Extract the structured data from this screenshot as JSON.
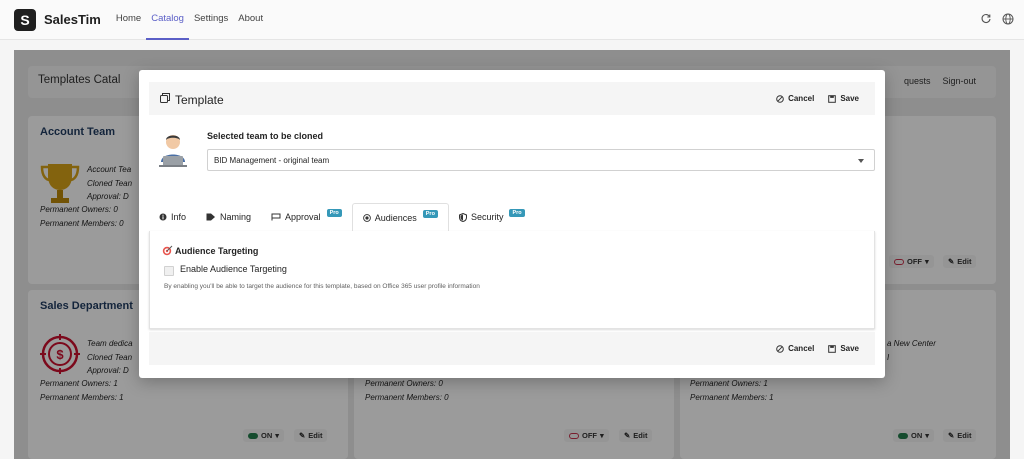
{
  "app": {
    "brand": "SalesTim",
    "logo_letter": "S",
    "nav": [
      "Home",
      "Catalog",
      "Settings",
      "About"
    ],
    "active_nav": "Catalog"
  },
  "background": {
    "catalog_title": "Templates Catal",
    "header_actions": [
      "quests",
      "Sign-out"
    ],
    "cards": [
      {
        "title": "Account Team",
        "lines": [
          "Account Tea",
          "Cloned Tean",
          "Approval: D"
        ],
        "owners": "Permanent Owners: 0",
        "members": "Permanent Members: 0",
        "state": "OFF"
      },
      {
        "title": "Sales Department",
        "lines": [
          "Team dedica",
          "Cloned Tean",
          "Approval: D"
        ],
        "owners": "Permanent Owners: 1",
        "members": "Permanent Members: 1",
        "state": "ON"
      },
      {
        "title": "",
        "lines": [],
        "owners": "Permanent Owners: 0",
        "members": "Permanent Members: 0",
        "state": "OFF"
      },
      {
        "title": "",
        "lines": [
          "a New Center",
          "I"
        ],
        "owners": "Permanent Owners: 1",
        "members": "Permanent Members: 1",
        "state": "ON"
      }
    ],
    "edit_label": "Edit"
  },
  "modal": {
    "title": "Template",
    "cancel_label": "Cancel",
    "save_label": "Save",
    "selected_team_label": "Selected team to be cloned",
    "selected_team_value": "BID Management - original team",
    "tabs": [
      {
        "label": "Info",
        "pro": false
      },
      {
        "label": "Naming",
        "pro": false
      },
      {
        "label": "Approval",
        "pro": true
      },
      {
        "label": "Audiences",
        "pro": true
      },
      {
        "label": "Security",
        "pro": true
      }
    ],
    "active_tab": "Audiences",
    "pro_badge": "Pro",
    "audience": {
      "heading": "Audience Targeting",
      "checkbox_label": "Enable Audience Targeting",
      "checked": false,
      "hint": "By enabling you'll be able to target the audience for this template, based on Office 365 user profile information"
    }
  },
  "colors": {
    "accent": "#5b5fc7",
    "pro_badge": "#3598b8",
    "toggle_on": "#237b4b",
    "toggle_off": "#c4314b"
  }
}
